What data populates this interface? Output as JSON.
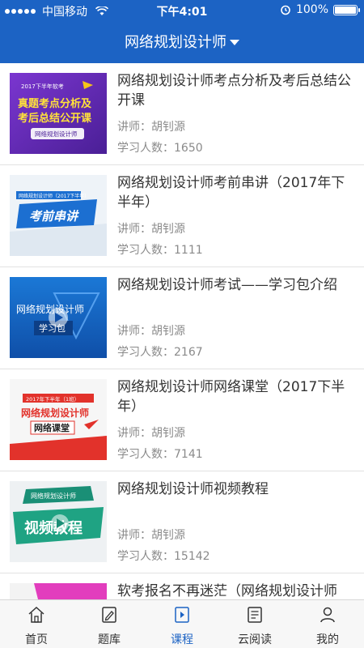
{
  "status": {
    "carrier": "中国移动",
    "time": "下午4:01",
    "battery": "100%"
  },
  "nav": {
    "title": "网络规划设计师"
  },
  "courses": [
    {
      "title": "网络规划设计师考点分析及考后总结公开课",
      "teacher": "讲师：胡钊源",
      "students": "学习人数：1650",
      "thumb": {
        "l1": "2017下半年软考",
        "l2": "真题考点分析及",
        "l3": "考后总结公开课",
        "l4": "网络规划设计师"
      }
    },
    {
      "title": "网络规划设计师考前串讲（2017年下半年）",
      "teacher": "讲师：胡钊源",
      "students": "学习人数：1111",
      "thumb": {
        "l1": "网络规划设计师（2017下半年）",
        "l2": "考前串讲"
      }
    },
    {
      "title": "网络规划设计师考试——学习包介绍",
      "teacher": "讲师：胡钊源",
      "students": "学习人数：2167",
      "thumb": {
        "l1": "网络规划设计师",
        "l2": "学习包"
      }
    },
    {
      "title": "网络规划设计师网络课堂（2017下半年）",
      "teacher": "讲师：胡钊源",
      "students": "学习人数：7141",
      "thumb": {
        "l1": "2017年下半年（1班）",
        "l2": "网络规划设计师",
        "l3": "网络课堂"
      }
    },
    {
      "title": "网络规划设计师视频教程",
      "teacher": "讲师：胡钊源",
      "students": "学习人数：15142",
      "thumb": {
        "l1": "网络规划设计师",
        "l2": "视频教程"
      }
    },
    {
      "title": "软考报名不再迷茫（网络规划设计师",
      "teacher": "",
      "students": "",
      "thumb": {}
    }
  ],
  "tabs": [
    {
      "label": "首页",
      "icon": "home-icon"
    },
    {
      "label": "题库",
      "icon": "edit-icon"
    },
    {
      "label": "课程",
      "icon": "play-book-icon",
      "active": true
    },
    {
      "label": "云阅读",
      "icon": "reader-icon"
    },
    {
      "label": "我的",
      "icon": "user-icon"
    }
  ],
  "colors": {
    "primary": "#1c63c4",
    "text": "#333333",
    "muted": "#8a8a8a"
  }
}
